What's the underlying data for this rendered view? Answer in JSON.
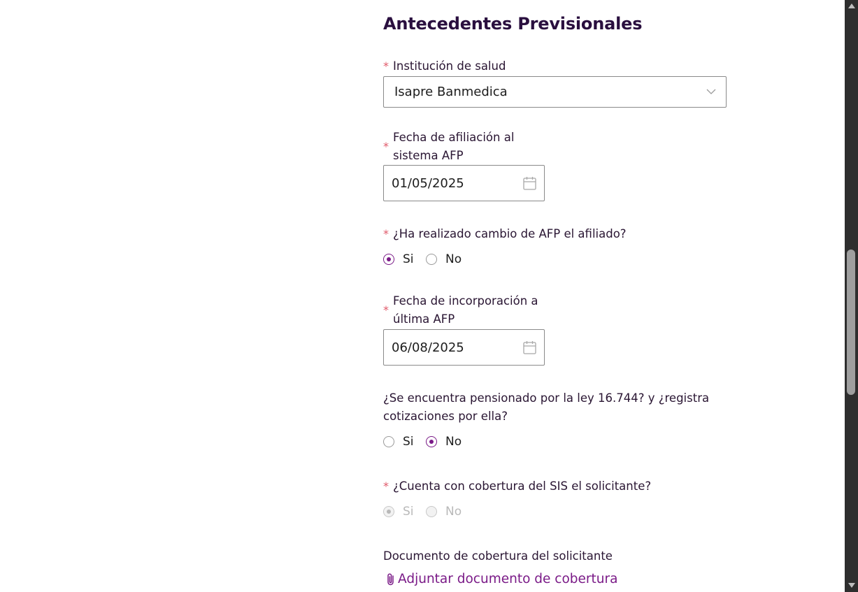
{
  "section": {
    "title": "Antecedentes Previsionales"
  },
  "health_institution": {
    "required_mark": "*",
    "label": "Institución de salud",
    "value": "Isapre Banmedica"
  },
  "afp_affiliation_date": {
    "required_mark": "*",
    "label_line1": "Fecha de afiliación al",
    "label_line2": "sistema AFP",
    "value": "01/05/2025"
  },
  "afp_change": {
    "required_mark": "*",
    "question": "¿Ha realizado cambio de AFP el afiliado?",
    "options": [
      "Si",
      "No"
    ],
    "selected": "Si"
  },
  "last_afp_date": {
    "required_mark": "*",
    "label_line1": "Fecha de incorporación a",
    "label_line2": "última AFP",
    "value": "06/08/2025"
  },
  "pension_law": {
    "question_line1": "¿Se encuentra pensionado por la ley 16.744? y ¿registra",
    "question_line2": "cotizaciones por ella?",
    "options": [
      "Si",
      "No"
    ],
    "selected": "No"
  },
  "sis_coverage": {
    "required_mark": "*",
    "question": "¿Cuenta con cobertura del SIS el solicitante?",
    "options": [
      "Si",
      "No"
    ],
    "selected": "Si",
    "disabled": true
  },
  "coverage_document": {
    "label": "Documento de cobertura del solicitante",
    "attach_label": "Adjuntar documento de cobertura",
    "icon": "paperclip-icon"
  },
  "colors": {
    "accent": "#7a1a87",
    "required": "#e05a6a",
    "title": "#2a0f3f"
  }
}
